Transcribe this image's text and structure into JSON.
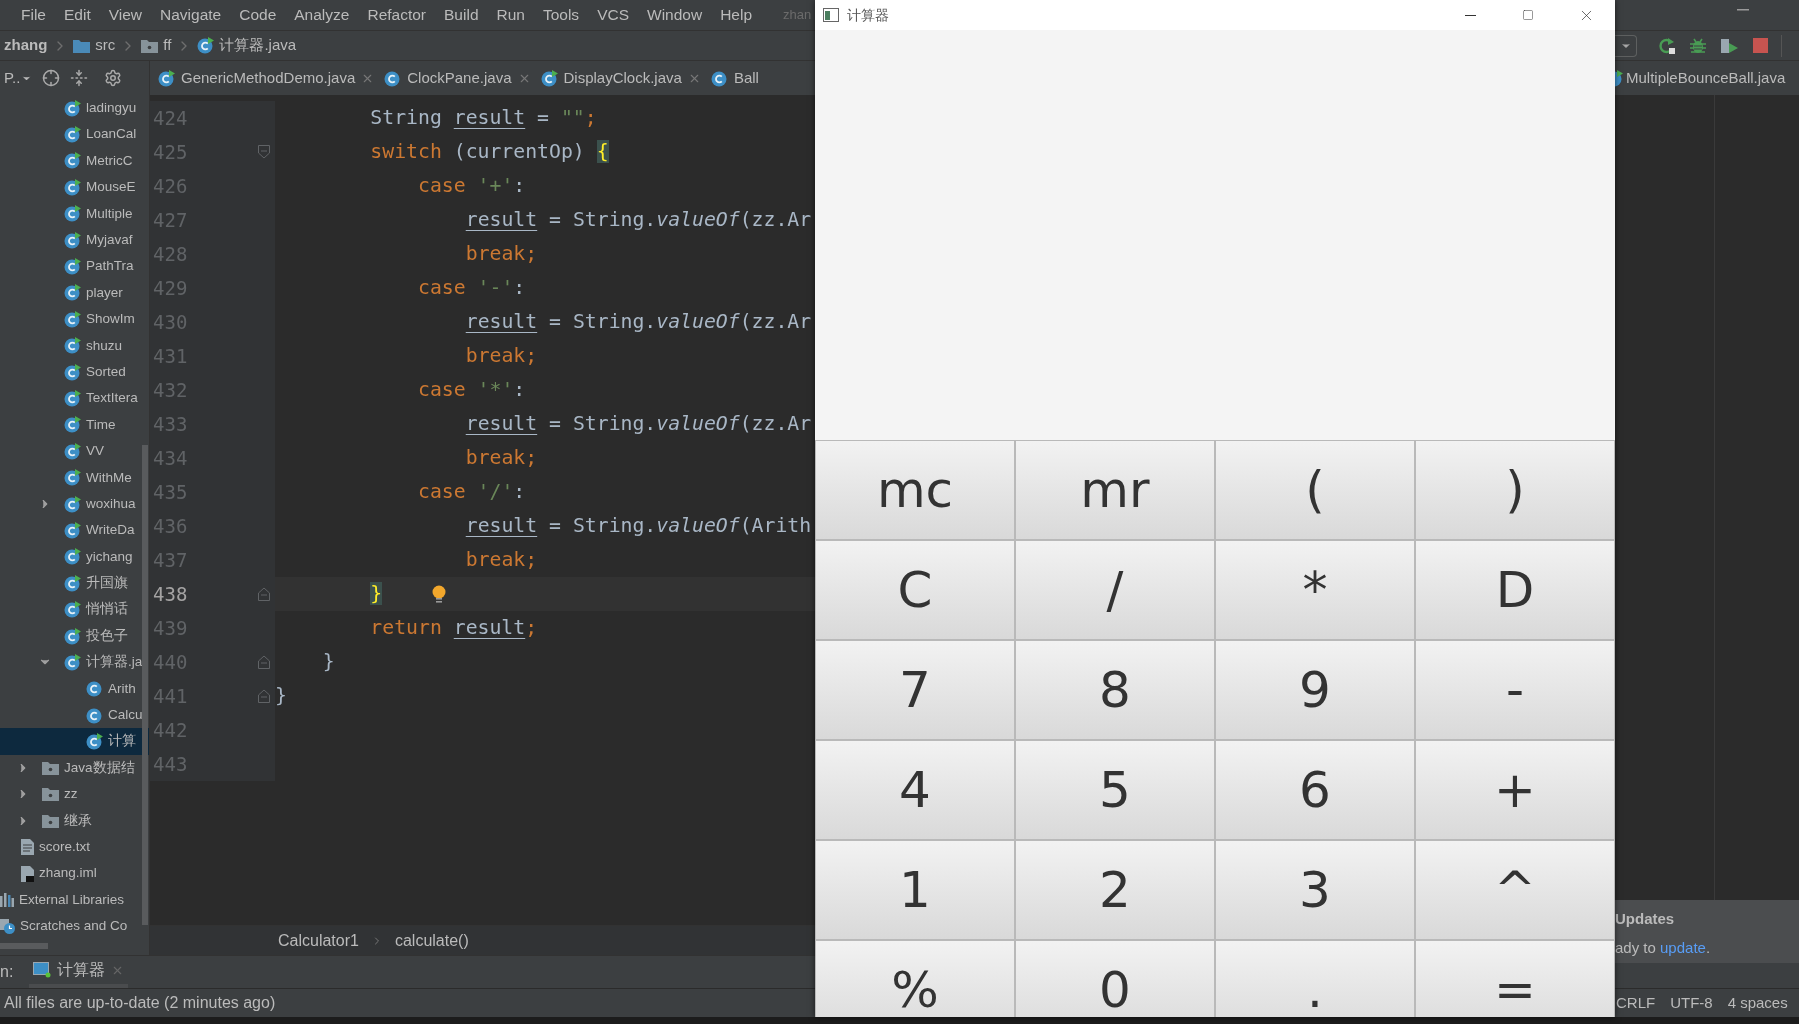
{
  "ide": {
    "menu": [
      "File",
      "Edit",
      "View",
      "Navigate",
      "Code",
      "Analyze",
      "Refactor",
      "Build",
      "Run",
      "Tools",
      "VCS",
      "Window",
      "Help"
    ],
    "title_fragment": "zhan",
    "breadcrumbs": [
      {
        "text": "zhang",
        "kind": "module"
      },
      {
        "text": "src",
        "kind": "source-folder"
      },
      {
        "text": "ff",
        "kind": "package"
      },
      {
        "text": "计算器.java",
        "kind": "class-run"
      }
    ],
    "project_view_label": "P..",
    "editor_tabs": [
      {
        "text": "GenericMethodDemo.java",
        "kind": "class-run"
      },
      {
        "text": "ClockPane.java",
        "kind": "class"
      },
      {
        "text": "DisplayClock.java",
        "kind": "class-run"
      },
      {
        "text": "Ball",
        "kind": "class"
      }
    ],
    "editor_tabs_right": [
      {
        "text": "MultipleBounceBall.java",
        "kind": "class-run"
      }
    ],
    "project_tree": [
      {
        "kind": "package",
        "items": [
          {
            "text": "ladingyu",
            "kind": "class-run",
            "selected": false
          },
          {
            "text": "LoanCal",
            "kind": "class-run",
            "selected": false
          },
          {
            "text": "MetricC",
            "kind": "class-run",
            "selected": false
          },
          {
            "text": "MouseE",
            "kind": "class-run",
            "selected": false
          },
          {
            "text": "Multiple",
            "kind": "class-run",
            "selected": false
          },
          {
            "text": "Myjavaf",
            "kind": "class-run",
            "selected": false
          },
          {
            "text": "PathTra",
            "kind": "class-run",
            "selected": false
          },
          {
            "text": "player",
            "kind": "class-run",
            "selected": false
          },
          {
            "text": "ShowIm",
            "kind": "class-run",
            "selected": false
          },
          {
            "text": "shuzu",
            "kind": "class-run",
            "selected": false
          },
          {
            "text": "Sorted",
            "kind": "class-run",
            "selected": false
          },
          {
            "text": "TextItera",
            "kind": "class-run",
            "selected": false
          },
          {
            "text": "Time",
            "kind": "class-run",
            "selected": false
          },
          {
            "text": "VV",
            "kind": "class-run",
            "selected": false
          },
          {
            "text": "WithMe",
            "kind": "class-run",
            "selected": false
          },
          {
            "text": "woxihua",
            "kind": "class-run",
            "selected": false,
            "expanded": false
          },
          {
            "text": "WriteDa",
            "kind": "class-run",
            "selected": false
          },
          {
            "text": "yichang",
            "kind": "class-run",
            "selected": false
          },
          {
            "text": "升国旗",
            "kind": "class-run",
            "selected": false
          },
          {
            "text": "悄悄话",
            "kind": "class-run",
            "selected": false
          },
          {
            "text": "投色子",
            "kind": "class-run",
            "selected": false
          },
          {
            "text": "计算器.ja",
            "kind": "class-run",
            "selected": false,
            "expanded": true,
            "children": [
              {
                "text": "Arith",
                "kind": "class",
                "selected": false
              },
              {
                "text": "Calcu",
                "kind": "class",
                "selected": false
              },
              {
                "text": "计算",
                "kind": "class-run",
                "selected": true
              }
            ]
          }
        ]
      },
      {
        "kind": "source",
        "items": [
          {
            "text": "Java数据结",
            "kind": "package",
            "selected": false,
            "expanded": false
          },
          {
            "text": "zz",
            "kind": "package",
            "selected": false,
            "expanded": false
          },
          {
            "text": "继承",
            "kind": "package",
            "selected": false,
            "expanded": false
          }
        ]
      },
      {
        "kind": "module",
        "items": [
          {
            "text": "score.txt",
            "kind": "text-file",
            "selected": false
          },
          {
            "text": "zhang.iml",
            "kind": "module-file",
            "selected": false
          }
        ]
      },
      {
        "kind": "root",
        "items": [
          {
            "text": "External Libraries",
            "kind": "libraries",
            "selected": false
          },
          {
            "text": "Scratches and Co",
            "kind": "scratches",
            "selected": false
          }
        ]
      }
    ],
    "code_lines": [
      {
        "number": "424",
        "kind": "method-body",
        "current": false,
        "bulb": false,
        "tokens": [
          {
            "text": "String ",
            "kind": "plain"
          },
          {
            "text": "result",
            "kind": "variable"
          },
          {
            "text": " = ",
            "kind": "plain"
          },
          {
            "text": "\"\"",
            "kind": "string"
          },
          {
            "text": ";",
            "kind": "keyword"
          }
        ]
      },
      {
        "number": "425",
        "kind": "method-body",
        "current": false,
        "bulb": false,
        "fold": {
          "kind": "start"
        },
        "tokens": [
          {
            "text": "switch",
            "kind": "keyword"
          },
          {
            "text": " (currentOp) ",
            "kind": "plain"
          },
          {
            "text": "{",
            "kind": "brace"
          }
        ]
      },
      {
        "number": "426",
        "kind": "switch-body",
        "current": false,
        "bulb": false,
        "tokens": [
          {
            "text": "case ",
            "kind": "keyword"
          },
          {
            "text": "'+'",
            "kind": "string"
          },
          {
            "text": ":",
            "kind": "plain"
          }
        ]
      },
      {
        "number": "427",
        "kind": "case-body",
        "current": false,
        "bulb": false,
        "tokens": [
          {
            "text": "result",
            "kind": "variable"
          },
          {
            "text": " = String.",
            "kind": "plain"
          },
          {
            "text": "valueOf",
            "kind": "method"
          },
          {
            "text": "(zz.Ar",
            "kind": "plain"
          }
        ]
      },
      {
        "number": "428",
        "kind": "case-body",
        "current": false,
        "bulb": false,
        "tokens": [
          {
            "text": "break;",
            "kind": "keyword"
          }
        ]
      },
      {
        "number": "429",
        "kind": "switch-body",
        "current": false,
        "bulb": false,
        "tokens": [
          {
            "text": "case ",
            "kind": "keyword"
          },
          {
            "text": "'-'",
            "kind": "string"
          },
          {
            "text": ":",
            "kind": "plain"
          }
        ]
      },
      {
        "number": "430",
        "kind": "case-body",
        "current": false,
        "bulb": false,
        "tokens": [
          {
            "text": "result",
            "kind": "variable"
          },
          {
            "text": " = String.",
            "kind": "plain"
          },
          {
            "text": "valueOf",
            "kind": "method"
          },
          {
            "text": "(zz.Ar",
            "kind": "plain"
          }
        ]
      },
      {
        "number": "431",
        "kind": "case-body",
        "current": false,
        "bulb": false,
        "tokens": [
          {
            "text": "break;",
            "kind": "keyword"
          }
        ]
      },
      {
        "number": "432",
        "kind": "switch-body",
        "current": false,
        "bulb": false,
        "tokens": [
          {
            "text": "case ",
            "kind": "keyword"
          },
          {
            "text": "'*'",
            "kind": "string"
          },
          {
            "text": ":",
            "kind": "plain"
          }
        ]
      },
      {
        "number": "433",
        "kind": "case-body",
        "current": false,
        "bulb": false,
        "tokens": [
          {
            "text": "result",
            "kind": "variable"
          },
          {
            "text": " = String.",
            "kind": "plain"
          },
          {
            "text": "valueOf",
            "kind": "method"
          },
          {
            "text": "(zz.Ar",
            "kind": "plain"
          }
        ]
      },
      {
        "number": "434",
        "kind": "case-body",
        "current": false,
        "bulb": false,
        "tokens": [
          {
            "text": "break;",
            "kind": "keyword"
          }
        ]
      },
      {
        "number": "435",
        "kind": "switch-body",
        "current": false,
        "bulb": false,
        "tokens": [
          {
            "text": "case ",
            "kind": "keyword"
          },
          {
            "text": "'/'",
            "kind": "string"
          },
          {
            "text": ":",
            "kind": "plain"
          }
        ]
      },
      {
        "number": "436",
        "kind": "case-body",
        "current": false,
        "bulb": false,
        "tokens": [
          {
            "text": "result",
            "kind": "variable"
          },
          {
            "text": " = String.",
            "kind": "plain"
          },
          {
            "text": "valueOf",
            "kind": "method"
          },
          {
            "text": "(Arith",
            "kind": "plain"
          }
        ]
      },
      {
        "number": "437",
        "kind": "case-body",
        "current": false,
        "bulb": false,
        "tokens": [
          {
            "text": "break;",
            "kind": "keyword"
          }
        ]
      },
      {
        "number": "438",
        "kind": "method-body",
        "current": true,
        "bulb": true,
        "fold": {
          "kind": "end"
        },
        "tokens": [
          {
            "text": "}",
            "kind": "brace"
          }
        ]
      },
      {
        "number": "439",
        "kind": "method-body",
        "current": false,
        "bulb": false,
        "tokens": [
          {
            "text": "return ",
            "kind": "keyword"
          },
          {
            "text": "result",
            "kind": "variable"
          },
          {
            "text": ";",
            "kind": "keyword"
          }
        ]
      },
      {
        "number": "440",
        "kind": "class-body",
        "current": false,
        "bulb": false,
        "fold": {
          "kind": "end"
        },
        "tokens": [
          {
            "text": "}",
            "kind": "plain"
          }
        ]
      },
      {
        "number": "441",
        "kind": "top",
        "current": false,
        "bulb": false,
        "fold": {
          "kind": "end"
        },
        "tokens": [
          {
            "text": "}",
            "kind": "plain"
          }
        ]
      },
      {
        "number": "442",
        "kind": "top",
        "current": false,
        "bulb": false
      },
      {
        "number": "443",
        "kind": "top",
        "current": false,
        "bulb": false
      }
    ],
    "editor_breadcrumb": [
      "Calculator1",
      "calculate()"
    ],
    "run_panel": {
      "label": "n:",
      "tabs": [
        {
          "text": "计算器"
        }
      ]
    },
    "notification": {
      "title": "Updates",
      "text_before": "ady to ",
      "link": "update",
      "text_after": "."
    },
    "status_bar": {
      "message": "All files are up-to-date (2 minutes ago)",
      "items": [
        "CRLF",
        "UTF-8",
        "4 spaces"
      ]
    }
  },
  "calculator": {
    "title": "计算器",
    "keys": [
      "mc",
      "mr",
      "(",
      ")",
      "C",
      "/",
      "*",
      "D",
      "7",
      "8",
      "9",
      "-",
      "4",
      "5",
      "6",
      "+",
      "1",
      "2",
      "3",
      "^",
      "%",
      "0",
      ".",
      "="
    ]
  }
}
